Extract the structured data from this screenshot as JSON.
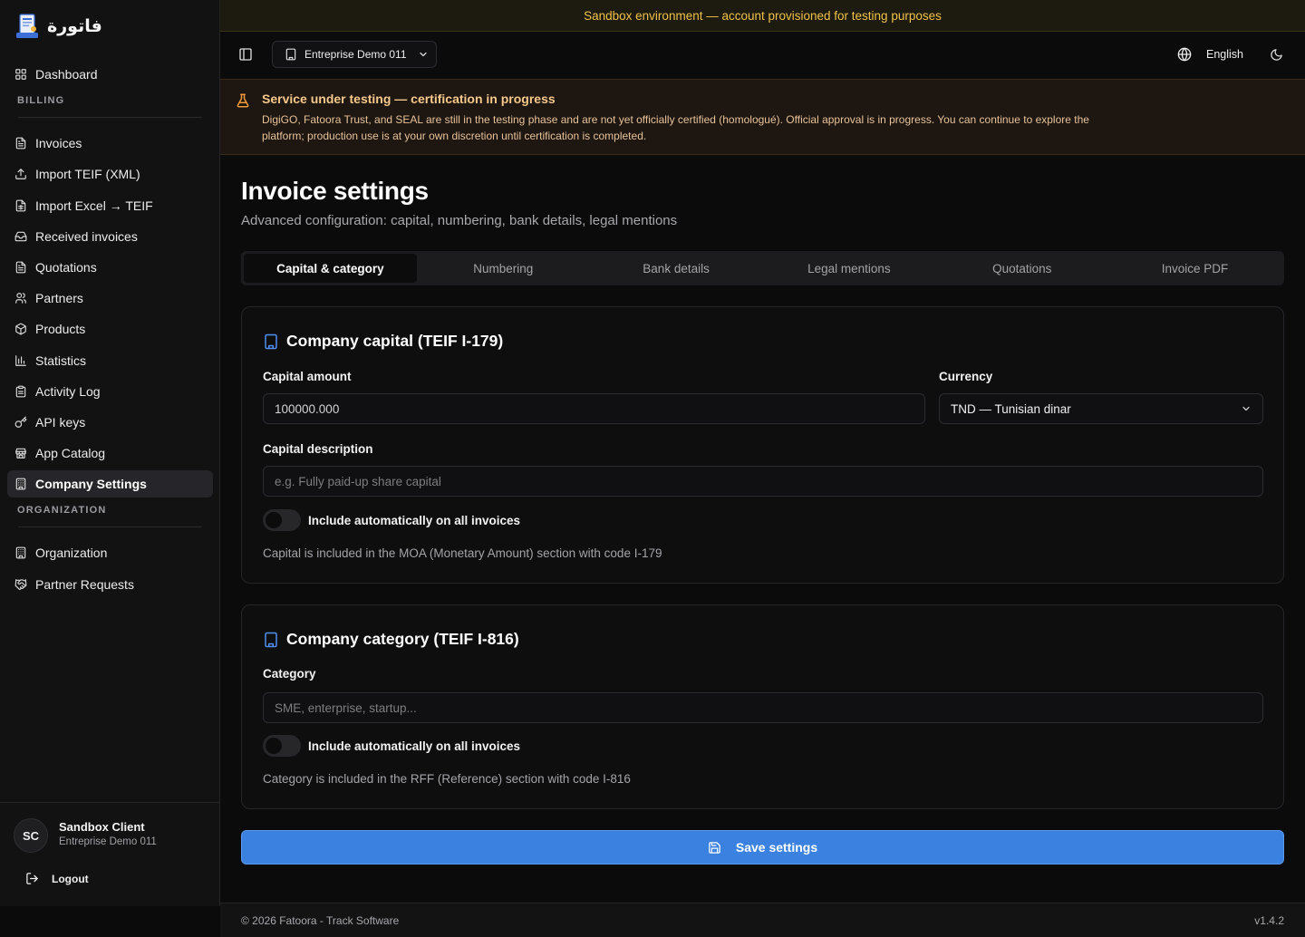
{
  "app": {
    "logo_text": "فاتورة",
    "logo_icon": "invoice-document-icon"
  },
  "sidebar": {
    "top_items": [
      {
        "label": "Dashboard",
        "icon": "grid-icon"
      }
    ],
    "sections": [
      {
        "title": "BILLING",
        "items": [
          {
            "label": "Invoices",
            "icon": "document-icon"
          },
          {
            "label": "Import TEIF (XML)",
            "icon": "upload-icon"
          },
          {
            "label": "Import Excel → TEIF",
            "icon": "spreadsheet-icon"
          },
          {
            "label": "Received invoices",
            "icon": "inbox-icon"
          },
          {
            "label": "Quotations",
            "icon": "document-icon"
          },
          {
            "label": "Partners",
            "icon": "users-icon"
          },
          {
            "label": "Products",
            "icon": "package-icon"
          },
          {
            "label": "Statistics",
            "icon": "bar-chart-icon"
          },
          {
            "label": "Activity Log",
            "icon": "clipboard-icon"
          },
          {
            "label": "API keys",
            "icon": "key-icon"
          },
          {
            "label": "App Catalog",
            "icon": "store-icon"
          },
          {
            "label": "Company Settings",
            "icon": "building-icon",
            "active": true
          }
        ]
      },
      {
        "title": "ORGANIZATION",
        "items": [
          {
            "label": "Organization",
            "icon": "building-icon"
          },
          {
            "label": "Partner Requests",
            "icon": "handshake-icon"
          }
        ]
      }
    ],
    "user": {
      "initials": "SC",
      "name": "Sandbox Client",
      "org": "Entreprise Demo 011"
    },
    "logout_label": "Logout"
  },
  "sandbox_banner": "Sandbox environment — account provisioned for testing purposes",
  "toolbar": {
    "org_selector": "Entreprise Demo 011",
    "language": "English"
  },
  "alert": {
    "title": "Service under testing — certification in progress",
    "body": "DigiGO, Fatoora Trust, and SEAL are still in the testing phase and are not yet officially certified (homologué). Official approval is in progress. You can continue to explore the platform; production use is at your own discretion until certification is completed.",
    "icon": "flask-icon",
    "color": "#f29a3b"
  },
  "page": {
    "title": "Invoice settings",
    "subtitle": "Advanced configuration: capital, numbering, bank details, legal mentions"
  },
  "tabs": [
    {
      "label": "Capital & category",
      "active": true
    },
    {
      "label": "Numbering"
    },
    {
      "label": "Bank details"
    },
    {
      "label": "Legal mentions"
    },
    {
      "label": "Quotations"
    },
    {
      "label": "Invoice PDF"
    }
  ],
  "capital_card": {
    "title": "Company capital (TEIF I-179)",
    "amount_label": "Capital amount",
    "amount_value": "100000.000",
    "currency_label": "Currency",
    "currency_value": "TND — Tunisian dinar",
    "description_label": "Capital description",
    "description_placeholder": "e.g. Fully paid-up share capital",
    "toggle_label": "Include automatically on all invoices",
    "toggle_on": false,
    "hint": "Capital is included in the MOA (Monetary Amount) section with code I-179"
  },
  "category_card": {
    "title": "Company category (TEIF I-816)",
    "category_label": "Category",
    "category_placeholder": "SME, enterprise, startup...",
    "toggle_label": "Include automatically on all invoices",
    "toggle_on": false,
    "hint": "Category is included in the RFF (Reference) section with code I-816"
  },
  "save_button": "Save settings",
  "footer": {
    "copyright": "© 2026 Fatoora - Track Software",
    "version": "v1.4.2"
  },
  "colors": {
    "accent": "#3b82e0",
    "banner": "#f0c24a",
    "warning": "#f29a3b"
  }
}
